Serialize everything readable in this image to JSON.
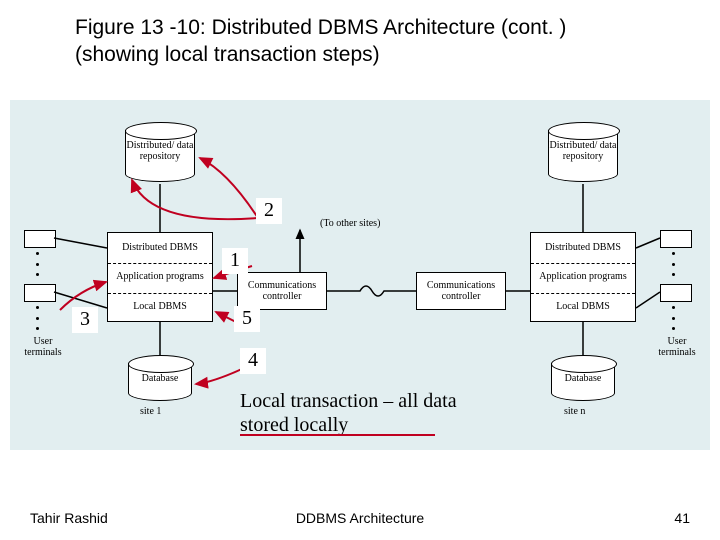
{
  "title_line1": "Figure 13 -10:  Distributed DBMS Architecture (cont. )",
  "title_line2": "(showing local transaction steps)",
  "repository_label": "Distributed/\ndata\nrepository",
  "dist_dbms_label": "Distributed\nDBMS",
  "app_prog_label": "Application\nprograms",
  "local_dbms_label": "Local\nDBMS",
  "comm_ctrl_label": "Communications\ncontroller",
  "to_other_sites": "(To other sites)",
  "database_label": "Database",
  "user_terminals_label": "User\nterminals",
  "site1_label": "site 1",
  "siten_label": "site n",
  "steps": {
    "s1": "1",
    "s2": "2",
    "s3": "3",
    "s4": "4",
    "s5": "5"
  },
  "caption": "Local transaction – all data stored locally",
  "footer_left": "Tahir Rashid",
  "footer_center": "DDBMS Architecture",
  "footer_right": "41"
}
